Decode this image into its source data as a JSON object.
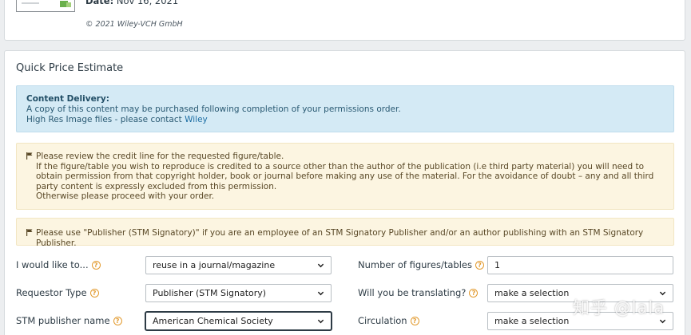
{
  "top": {
    "date_label": "Date:",
    "date_value": "Nov 16, 2021",
    "copyright": "© 2021 Wiley-VCH GmbH"
  },
  "estimate": {
    "title": "Quick Price Estimate",
    "content_delivery": {
      "title": "Content Delivery:",
      "line1": "A copy of this content may be purchased following completion of your permissions order.",
      "line2_prefix": "High Res Image files - please contact ",
      "line2_link": "Wiley"
    },
    "notice1": {
      "line1": "Please review the credit line for the requested figure/table.",
      "line2": "If the figure/table you wish to reproduce is credited to a source other than the author of the publication (i.e third party material) you will need to obtain permission from that copyright holder, book or journal before making any use of the material. For the avoidance of doubt – any and all third party content is expressly excluded from this permission.",
      "line3": "Otherwise please proceed with your order."
    },
    "notice2": "Please use \"Publisher (STM Signatory)\" if you are an employee of an STM Signatory Publisher and/or an author publishing with an STM Signatory Publisher."
  },
  "form": {
    "would_like_label": "I would like to...",
    "would_like_value": "reuse in a journal/magazine",
    "requestor_label": "Requestor Type",
    "requestor_value": "Publisher (STM Signatory)",
    "stm_label": "STM publisher name",
    "stm_value": "American Chemical Society",
    "figures_label": "Number of figures/tables",
    "figures_value": "1",
    "translating_label": "Will you be translating?",
    "translating_value": "make a selection",
    "circulation_label": "Circulation",
    "circulation_value": "make a selection"
  },
  "watermark": "知乎 @lala",
  "colors": {
    "info_bg": "#d4eaf5",
    "warn_bg": "#fcf5e1",
    "help_icon": "#e29a2e",
    "link": "#1c6ea4"
  }
}
